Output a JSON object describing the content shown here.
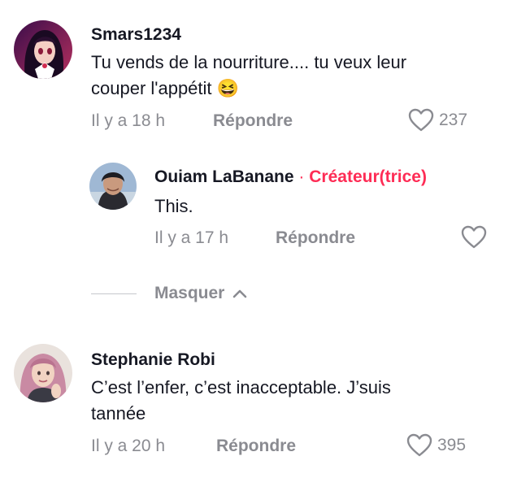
{
  "comments": [
    {
      "username": "Smars1234",
      "text_line1": "Tu vends de la nourriture.... tu veux leur",
      "text_line2": "couper l'appétit",
      "emoji": "😆",
      "time": "Il y a 18 h",
      "reply_label": "Répondre",
      "likes": "237"
    },
    {
      "username": "Ouiam LaBanane",
      "creator_sep": "·",
      "creator_badge": "Créateur(trice)",
      "text": "This.",
      "time": "Il y a 17 h",
      "reply_label": "Répondre",
      "likes": ""
    },
    {
      "username": "Stephanie Robi",
      "text_line1": "C’est l’enfer, c’est inacceptable. J’suis",
      "text_line2": "tannée",
      "time": "Il y a 20 h",
      "reply_label": "Répondre",
      "likes": "395"
    }
  ],
  "hide_replies": {
    "label": "Masquer",
    "icon": "chevron-up-icon"
  },
  "colors": {
    "accent": "#fe2c55",
    "secondary_text": "#8a8b91",
    "primary_text": "#161823"
  }
}
